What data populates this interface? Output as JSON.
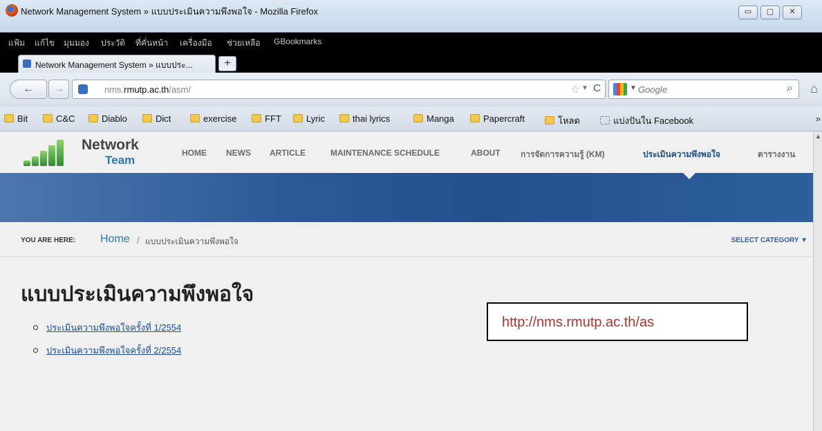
{
  "window": {
    "title": "Network Management System » แบบประเมินความพึงพอใจ - Mozilla Firefox",
    "controls": [
      "▭",
      "▢",
      "✕"
    ]
  },
  "menubar": {
    "items": [
      "แฟ้ม",
      "แก้ไข",
      "มุมมอง",
      "ประวัติ",
      "ที่คั่นหน้า",
      "เครื่องมือ",
      "ช่วยเหลือ",
      "GBookmarks"
    ]
  },
  "tabs": {
    "active_label": "Network Management System » แบบประ...",
    "new_tab_symbol": "+"
  },
  "navbar": {
    "back_symbol": "←",
    "forward_symbol": "→",
    "url_host_prefix": "nms.",
    "url_host_main": "rmutp.ac.th",
    "url_path": "/asm/",
    "star_symbol": "☆",
    "reload_symbol": "C",
    "search_placeholder": "Google",
    "search_symbol": "⌕",
    "home_symbol": "⌂"
  },
  "bookmarks": {
    "items": [
      "Bit",
      "C&C",
      "Diablo",
      "Dict",
      "exercise",
      "FFT",
      "Lyric",
      "thai lyrics",
      "Manga",
      "Papercraft",
      "โหลด",
      "แบ่งปันใน Facebook"
    ],
    "more_symbol": "»"
  },
  "site": {
    "logo_line1": "Network",
    "logo_line2": "Team",
    "nav": [
      "HOME",
      "NEWS",
      "ARTICLE",
      "MAINTENANCE SCHEDULE",
      "ABOUT",
      "การจัดการความรู้ (KM)",
      "ประเมินความพึงพอใจ",
      "ตารางงาน"
    ],
    "active_nav_index": 6,
    "breadcrumb_label": "YOU ARE HERE:",
    "breadcrumb_home": "Home",
    "breadcrumb_sep": "/",
    "breadcrumb_current": "แบบประเมินความพึงพอใจ",
    "select_category": "SELECT CATEGORY ▼",
    "page_heading": "แบบประเมินความพึงพอใจ",
    "links": [
      "ประเมินความพึงพอใจครั้งที่ 1/2554",
      "ประเมินความพึงพอใจครั้งที่ 2/2554"
    ]
  },
  "annotation": {
    "url_text": "http://nms.rmutp.ac.th/as"
  },
  "colors": {
    "banner": "#2a5a98",
    "active_nav": "#1f4f86",
    "link": "#1a4f9c",
    "annotation_text": "#b0342c"
  }
}
